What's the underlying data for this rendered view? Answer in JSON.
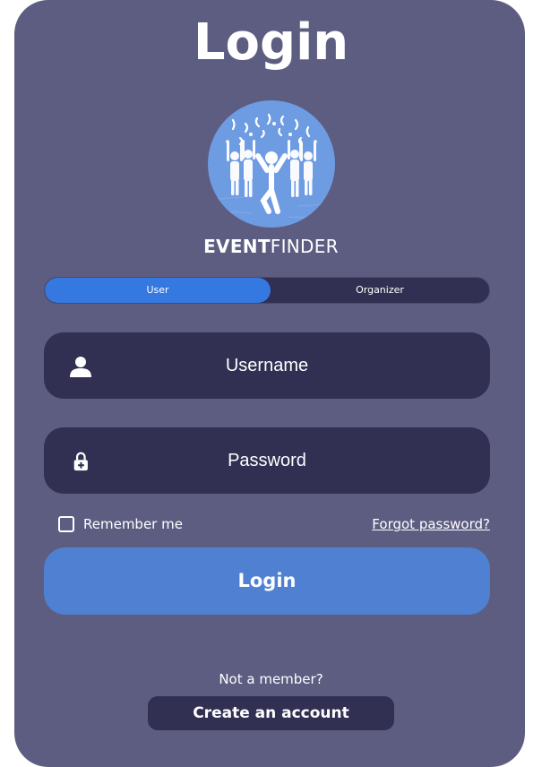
{
  "page": {
    "title": "Login"
  },
  "brand": {
    "name_bold": "EVENT",
    "name_light": "FINDER",
    "logo_icon": "celebrating-crowd-icon"
  },
  "role_toggle": {
    "options": [
      {
        "label": "User",
        "selected": true
      },
      {
        "label": "Organizer",
        "selected": false
      }
    ]
  },
  "username_field": {
    "placeholder": "Username",
    "value": "",
    "icon": "user-icon"
  },
  "password_field": {
    "placeholder": "Password",
    "value": "",
    "icon": "lock-icon"
  },
  "remember": {
    "label": "Remember me",
    "checked": false
  },
  "forgot_link": "Forgot password?",
  "login_button": "Login",
  "signup": {
    "prompt": "Not a member?",
    "button": "Create an account"
  },
  "colors": {
    "card_background": "#5d5d82",
    "field_background": "#312f52",
    "accent_blue": "#3478e0",
    "login_button": "#4f80d2",
    "logo_circle": "#6e9ce2",
    "text": "#ffffff"
  }
}
